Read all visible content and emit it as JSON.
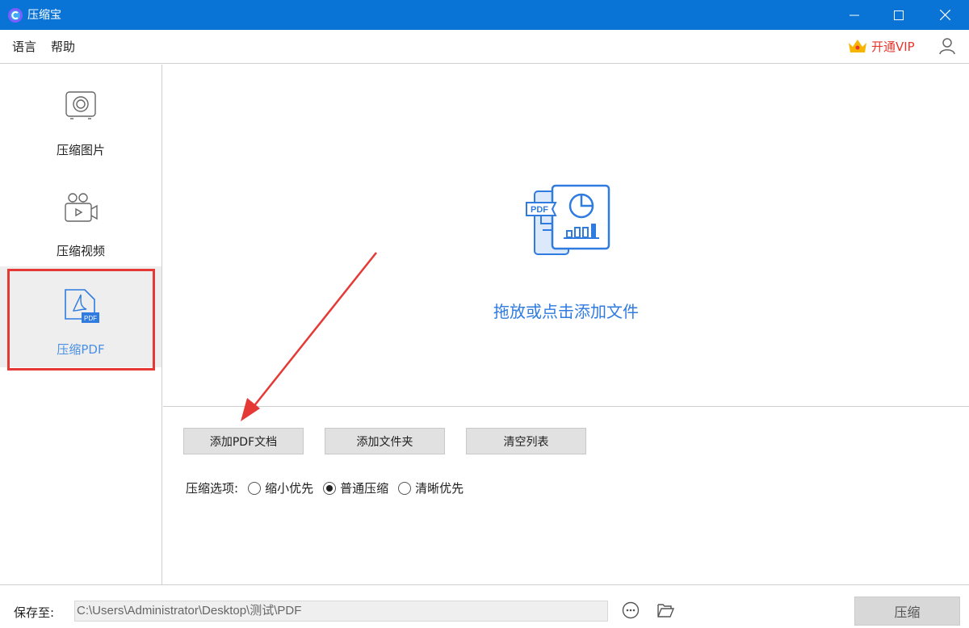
{
  "window": {
    "title": "压缩宝"
  },
  "menu": {
    "language": "语言",
    "help": "帮助"
  },
  "header": {
    "vip_label": "开通VIP"
  },
  "sidebar": {
    "items": [
      {
        "label": "压缩图片",
        "icon": "camera-icon",
        "active": false
      },
      {
        "label": "压缩视频",
        "icon": "video-camera-icon",
        "active": false
      },
      {
        "label": "压缩PDF",
        "icon": "pdf-file-icon",
        "active": true
      }
    ]
  },
  "dropzone": {
    "text": "拖放或点击添加文件",
    "illustration_badge": "PDF"
  },
  "actions": {
    "add_pdf": "添加PDF文档",
    "add_folder": "添加文件夹",
    "clear_list": "清空列表"
  },
  "options": {
    "label": "压缩选项:",
    "choices": [
      {
        "label": "缩小优先",
        "selected": false
      },
      {
        "label": "普通压缩",
        "selected": true
      },
      {
        "label": "清晰优先",
        "selected": false
      }
    ]
  },
  "footer": {
    "save_label": "保存至:",
    "path": "C:\\Users\\Administrator\\Desktop\\测试\\PDF",
    "compress_button": "压缩"
  },
  "colors": {
    "titlebar": "#0a74d6",
    "accent": "#2f7be0",
    "vip": "#e8372d",
    "highlight": "#e53935"
  }
}
